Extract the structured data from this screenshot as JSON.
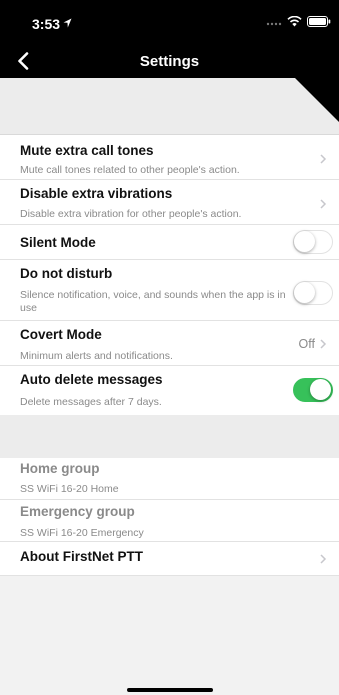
{
  "status_bar": {
    "time": "3:53"
  },
  "nav": {
    "title": "Settings",
    "back_icon": "chevron-left-icon"
  },
  "settings": {
    "mute_extra_call_tones": {
      "title": "Mute extra call tones",
      "subtitle": "Mute call tones related to other people's action."
    },
    "disable_extra_vibrations": {
      "title": "Disable extra vibrations",
      "subtitle": "Disable extra vibration for other people's action."
    },
    "silent_mode": {
      "title": "Silent Mode",
      "enabled": false
    },
    "do_not_disturb": {
      "title": "Do not disturb",
      "subtitle": "Silence notification, voice, and sounds when the app is in use",
      "enabled": false
    },
    "covert_mode": {
      "title": "Covert Mode",
      "subtitle": "Minimum alerts and notifications.",
      "value": "Off"
    },
    "auto_delete_messages": {
      "title": "Auto delete messages",
      "subtitle": "Delete messages after 7 days.",
      "enabled": true
    }
  },
  "groups": {
    "home_group": {
      "title": "Home group",
      "subtitle": "SS WiFi 16-20 Home"
    },
    "emergency_group": {
      "title": "Emergency group",
      "subtitle": "SS WiFi 16-20 Emergency"
    },
    "about": {
      "title": "About FirstNet PTT"
    }
  },
  "colors": {
    "toggle_on": "#37c15a",
    "nav_background": "#000000",
    "subtitle_gray": "#8a8a8a"
  }
}
